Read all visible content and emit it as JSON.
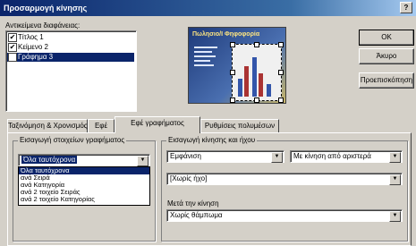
{
  "dialog": {
    "title": "Προσαρμογή κίνησης",
    "help_label": "?"
  },
  "objects": {
    "label": "Αντικείμενα διαφάνειας:",
    "items": [
      {
        "label": "Τίτλος 1",
        "checked": "✔"
      },
      {
        "label": "Κείμενο 2",
        "checked": "✔"
      },
      {
        "label": "Γράφημα 3",
        "checked": "✔"
      }
    ]
  },
  "preview": {
    "slide_title": "Πωλησιο/Ι Φηφοφορία",
    "accent_color": "#1e3a7a"
  },
  "buttons": {
    "ok": "OK",
    "cancel": "Άκυρο",
    "preview": "Προεπισκόπηση"
  },
  "tabs": [
    "Ταξινόμηση & Χρονισμός",
    "Εφέ",
    "Εφέ γραφήματος",
    "Ρυθμίσεις πολυμέσων"
  ],
  "chart_effects": {
    "group_label": "Εισαγωγή στοιχείων γραφήματος",
    "combo_value": "Όλα ταυτόχρονα",
    "options": [
      "Όλα ταυτόχρονα",
      "ανά Σειρά",
      "ανά Κατηγορία",
      "ανά 2 τοιχείο Σειράς",
      "ανά 2 τοιχείο Κατηγορίας"
    ]
  },
  "animation": {
    "group_label": "Εισαγωγή κίνησης και ήχου",
    "effect_value": "Εμφάνιση",
    "direction_value": "Με κίνηση από αριστερά",
    "sound_value": "[Χωρίς ήχο]",
    "after_label": "Μετά την κίνηση",
    "after_value": "Χωρίς θάμπωμα"
  }
}
